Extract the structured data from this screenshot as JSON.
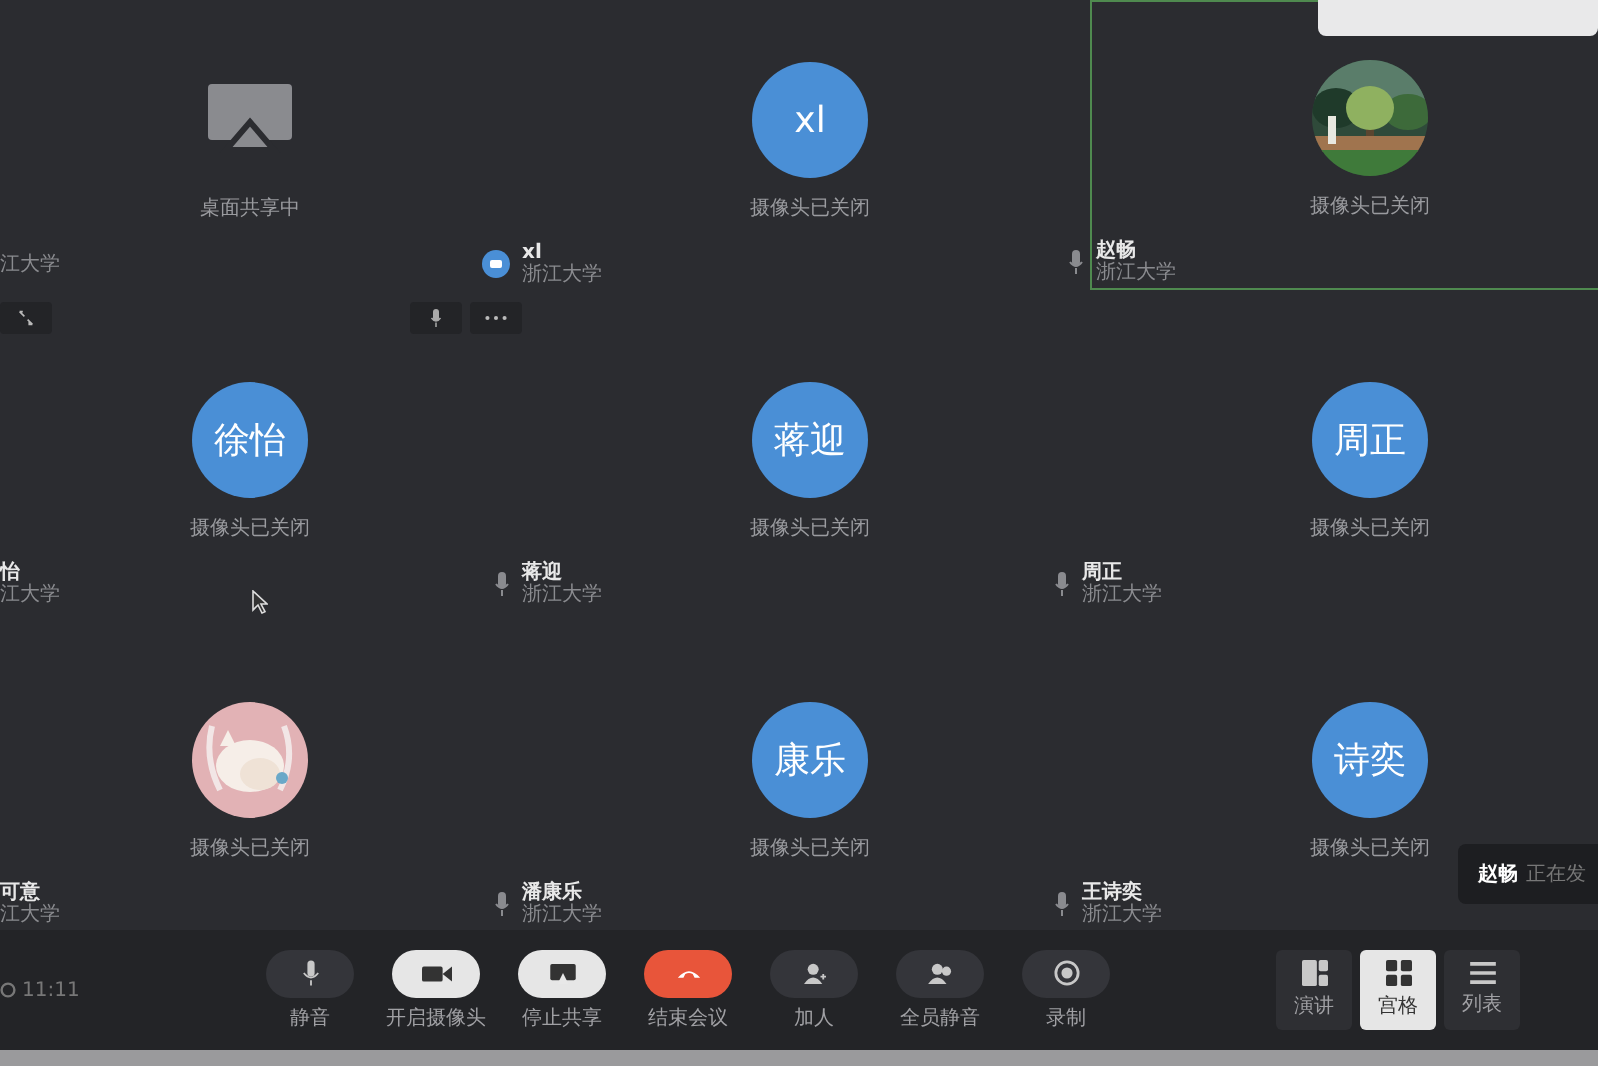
{
  "tiles": [
    {
      "avatar": {
        "kind": "share"
      },
      "status": "桌面共享中",
      "org": "江大学",
      "hover_controls": [
        {
          "kind": "expand"
        }
      ]
    },
    {
      "avatar": {
        "kind": "initials",
        "text": "xl"
      },
      "status": "摄像头已关闭",
      "name": "xl",
      "org": "浙江大学",
      "indicator": {
        "kind": "video"
      },
      "hover_controls": [
        {
          "kind": "mic"
        },
        {
          "kind": "more"
        }
      ]
    },
    {
      "status": "摄像头已关闭",
      "name": "赵畅",
      "org": "浙江大学",
      "indicator": {
        "kind": "mic"
      },
      "speaking": true
    },
    {
      "avatar": {
        "kind": "initials",
        "text": "徐怡"
      },
      "status": "摄像头已关闭",
      "name": "怡",
      "org": "江大学"
    },
    {
      "avatar": {
        "kind": "initials",
        "text": "蒋迎"
      },
      "status": "摄像头已关闭",
      "name": "蒋迎",
      "org": "浙江大学",
      "indicator": {
        "kind": "mic"
      }
    },
    {
      "avatar": {
        "kind": "initials",
        "text": "周正"
      },
      "status": "摄像头已关闭",
      "name": "周正",
      "org": "浙江大学",
      "indicator": {
        "kind": "mic"
      }
    },
    {
      "avatar": {
        "kind": "cartoon"
      },
      "status": "摄像头已关闭",
      "name": "可意",
      "org": "江大学"
    },
    {
      "avatar": {
        "kind": "initials",
        "text": "康乐"
      },
      "status": "摄像头已关闭",
      "name": "潘康乐",
      "org": "浙江大学",
      "indicator": {
        "kind": "mic"
      }
    },
    {
      "avatar": {
        "kind": "initials",
        "text": "诗奕"
      },
      "status": "摄像头已关闭",
      "name": "王诗奕",
      "org": "浙江大学",
      "indicator": {
        "kind": "mic"
      }
    }
  ],
  "toast": {
    "name": "赵畅",
    "message": "正在发"
  },
  "timer": "11:11",
  "toolbar": [
    {
      "label": "静音"
    },
    {
      "label": "开启摄像头"
    },
    {
      "label": "停止共享"
    },
    {
      "label": "结束会议"
    },
    {
      "label": "加人"
    },
    {
      "label": "全员静音"
    },
    {
      "label": "录制"
    }
  ],
  "views": [
    {
      "label": "演讲",
      "selected": false
    },
    {
      "label": "宫格",
      "selected": true
    },
    {
      "label": "列表",
      "selected": false
    }
  ]
}
